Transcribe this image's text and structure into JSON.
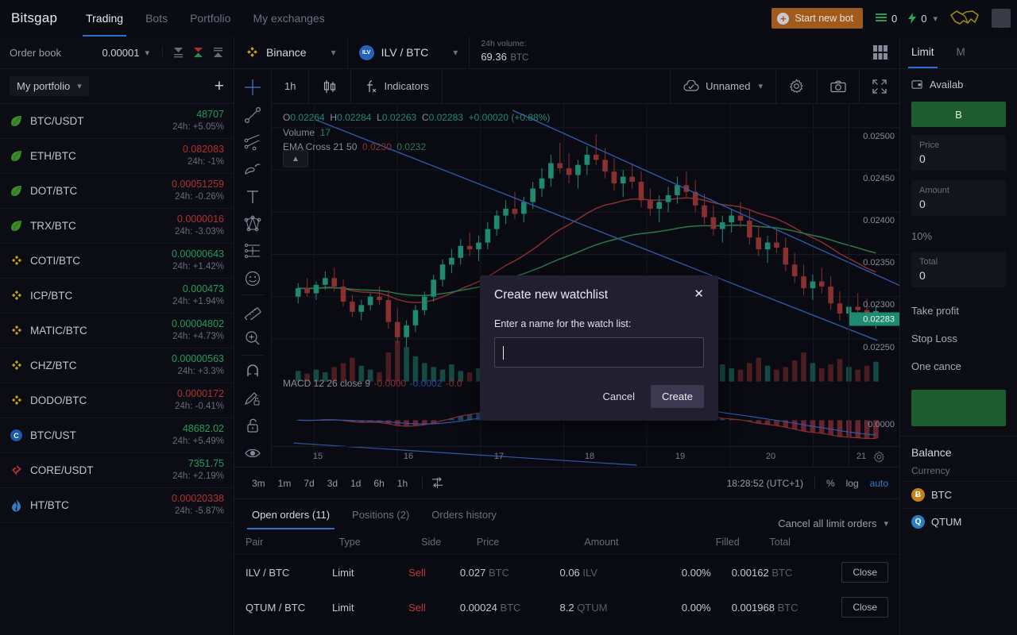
{
  "nav": {
    "brand": "Bitsgap",
    "items": [
      {
        "label": "Trading",
        "active": true
      },
      {
        "label": "Bots",
        "active": false
      },
      {
        "label": "Portfolio",
        "active": false
      },
      {
        "label": "My exchanges",
        "active": false
      }
    ],
    "start_bot_label": "Start new bot",
    "counter_list": "0",
    "counter_bolt": "0"
  },
  "orderbook": {
    "title": "Order book",
    "tick_size": "0.00001"
  },
  "portfolio": {
    "selector_label": "My portfolio",
    "add_label": "+",
    "pairs": [
      {
        "name": "BTC/USDT",
        "price": "48707",
        "change": "24h: +5.05%",
        "dir": "up",
        "icon": "leaf"
      },
      {
        "name": "ETH/BTC",
        "price": "0.082083",
        "change": "24h: -1%",
        "dir": "down",
        "icon": "leaf"
      },
      {
        "name": "DOT/BTC",
        "price": "0.00051259",
        "change": "24h: -0.26%",
        "dir": "down",
        "icon": "leaf"
      },
      {
        "name": "TRX/BTC",
        "price": "0.0000016",
        "change": "24h: -3.03%",
        "dir": "down",
        "icon": "leaf"
      },
      {
        "name": "COTI/BTC",
        "price": "0.00000643",
        "change": "24h: +1.42%",
        "dir": "up",
        "icon": "binance"
      },
      {
        "name": "ICP/BTC",
        "price": "0.000473",
        "change": "24h: +1.94%",
        "dir": "up",
        "icon": "binance"
      },
      {
        "name": "MATIC/BTC",
        "price": "0.00004802",
        "change": "24h: +4.73%",
        "dir": "up",
        "icon": "binance"
      },
      {
        "name": "CHZ/BTC",
        "price": "0.00000563",
        "change": "24h: +3.3%",
        "dir": "up",
        "icon": "binance"
      },
      {
        "name": "DODO/BTC",
        "price": "0.0000172",
        "change": "24h: -0.41%",
        "dir": "down",
        "icon": "binance"
      },
      {
        "name": "BTC/UST",
        "price": "48682.02",
        "change": "24h: +5.49%",
        "dir": "up",
        "icon": "circle-c"
      },
      {
        "name": "CORE/USDT",
        "price": "7351.75",
        "change": "24h: +2.19%",
        "dir": "up",
        "icon": "gate"
      },
      {
        "name": "HT/BTC",
        "price": "0.00020338",
        "change": "24h: -5.87%",
        "dir": "down",
        "icon": "huobi"
      }
    ]
  },
  "market": {
    "exchange": "Binance",
    "pair": "ILV / BTC",
    "pair_badge": "ILV",
    "volume_label": "24h volume:",
    "volume_value": "69.36",
    "volume_unit": "BTC"
  },
  "chart": {
    "timeframe": "1h",
    "indicators_label": "Indicators",
    "layout_name": "Unnamed",
    "ohlc": {
      "o_label": "O",
      "o": "0.02264",
      "h_label": "H",
      "h": "0.02284",
      "l_label": "L",
      "l": "0.02263",
      "c_label": "C",
      "c": "0.02283",
      "change": "+0.00020",
      "change_pct": "(+0.88%)"
    },
    "volume_label": "Volume",
    "volume_value": "17",
    "ema_label": "EMA Cross 21 50",
    "ema_fast": "0.0230",
    "ema_slow": "0.0232",
    "macd_label": "MACD 12 26 close 9",
    "macd_v1": "-0.0000",
    "macd_v2": "-0.0002",
    "macd_v3": "-0.0",
    "price_ticks": [
      "0.02500",
      "0.02450",
      "0.02400",
      "0.02350",
      "0.02300",
      "0.02250"
    ],
    "current_price": "0.02283",
    "zero_tick": "0.0000",
    "time_ticks": [
      "15",
      "16",
      "17",
      "18",
      "19",
      "20",
      "21"
    ],
    "timeframes": [
      "3m",
      "1m",
      "7d",
      "3d",
      "1d",
      "6h",
      "1h"
    ],
    "clock": "18:28:52 (UTC+1)",
    "pct_label": "%",
    "log_label": "log",
    "auto_label": "auto"
  },
  "chart_data": {
    "type": "candlestick",
    "title": "ILV / BTC 1h",
    "xlabel": "",
    "ylabel": "",
    "ylim": [
      0.0222,
      0.02515
    ],
    "xticks": [
      "15",
      "16",
      "17",
      "18",
      "19",
      "20",
      "21"
    ],
    "yticks": [
      0.0225,
      0.023,
      0.0235,
      0.024,
      0.0245,
      0.025
    ],
    "grid": true,
    "legend": "none",
    "up_color": "#1f8a72",
    "down_color": "#8a3030",
    "ema_fast_color": "#8a2f2f",
    "ema_slow_color": "#2a7a4a",
    "trendline_color": "#2f5aa8",
    "last_close": 0.02283,
    "candles": [
      {
        "o": 0.023,
        "h": 0.02316,
        "l": 0.02292,
        "c": 0.0231
      },
      {
        "o": 0.0231,
        "h": 0.02322,
        "l": 0.023,
        "c": 0.02304
      },
      {
        "o": 0.02304,
        "h": 0.02318,
        "l": 0.02296,
        "c": 0.02314
      },
      {
        "o": 0.02314,
        "h": 0.0233,
        "l": 0.02308,
        "c": 0.02322
      },
      {
        "o": 0.02322,
        "h": 0.02334,
        "l": 0.02306,
        "c": 0.02312
      },
      {
        "o": 0.02312,
        "h": 0.0232,
        "l": 0.02288,
        "c": 0.02294
      },
      {
        "o": 0.02294,
        "h": 0.02302,
        "l": 0.02276,
        "c": 0.02282
      },
      {
        "o": 0.02282,
        "h": 0.02296,
        "l": 0.02272,
        "c": 0.0229
      },
      {
        "o": 0.0229,
        "h": 0.02304,
        "l": 0.02284,
        "c": 0.023
      },
      {
        "o": 0.023,
        "h": 0.02312,
        "l": 0.0229,
        "c": 0.02296
      },
      {
        "o": 0.02296,
        "h": 0.02308,
        "l": 0.02262,
        "c": 0.0227
      },
      {
        "o": 0.0227,
        "h": 0.02286,
        "l": 0.02244,
        "c": 0.02252
      },
      {
        "o": 0.02252,
        "h": 0.02272,
        "l": 0.0224,
        "c": 0.02266
      },
      {
        "o": 0.02266,
        "h": 0.0229,
        "l": 0.02258,
        "c": 0.02284
      },
      {
        "o": 0.02284,
        "h": 0.02306,
        "l": 0.02278,
        "c": 0.023
      },
      {
        "o": 0.023,
        "h": 0.02326,
        "l": 0.02294,
        "c": 0.0232
      },
      {
        "o": 0.0232,
        "h": 0.02344,
        "l": 0.02312,
        "c": 0.02338
      },
      {
        "o": 0.02338,
        "h": 0.02356,
        "l": 0.02328,
        "c": 0.02346
      },
      {
        "o": 0.02346,
        "h": 0.02368,
        "l": 0.02338,
        "c": 0.0236
      },
      {
        "o": 0.0236,
        "h": 0.02376,
        "l": 0.02348,
        "c": 0.02356
      },
      {
        "o": 0.02356,
        "h": 0.02372,
        "l": 0.02342,
        "c": 0.02364
      },
      {
        "o": 0.02364,
        "h": 0.02388,
        "l": 0.02356,
        "c": 0.0238
      },
      {
        "o": 0.0238,
        "h": 0.02402,
        "l": 0.02372,
        "c": 0.02396
      },
      {
        "o": 0.02396,
        "h": 0.02414,
        "l": 0.02386,
        "c": 0.02404
      },
      {
        "o": 0.02404,
        "h": 0.02424,
        "l": 0.02392,
        "c": 0.02398
      },
      {
        "o": 0.02398,
        "h": 0.02418,
        "l": 0.02388,
        "c": 0.02412
      },
      {
        "o": 0.02412,
        "h": 0.02436,
        "l": 0.02404,
        "c": 0.02428
      },
      {
        "o": 0.02428,
        "h": 0.02452,
        "l": 0.02418,
        "c": 0.0244
      },
      {
        "o": 0.0244,
        "h": 0.02468,
        "l": 0.0243,
        "c": 0.02458
      },
      {
        "o": 0.02458,
        "h": 0.02482,
        "l": 0.02446,
        "c": 0.02452
      },
      {
        "o": 0.02452,
        "h": 0.0247,
        "l": 0.02434,
        "c": 0.02444
      },
      {
        "o": 0.02444,
        "h": 0.02462,
        "l": 0.02428,
        "c": 0.02456
      },
      {
        "o": 0.02456,
        "h": 0.02478,
        "l": 0.02444,
        "c": 0.02468
      },
      {
        "o": 0.02468,
        "h": 0.02492,
        "l": 0.02456,
        "c": 0.02462
      },
      {
        "o": 0.02462,
        "h": 0.02476,
        "l": 0.0244,
        "c": 0.02448
      },
      {
        "o": 0.02448,
        "h": 0.02464,
        "l": 0.02426,
        "c": 0.02434
      },
      {
        "o": 0.02434,
        "h": 0.0245,
        "l": 0.02418,
        "c": 0.02442
      },
      {
        "o": 0.02442,
        "h": 0.02458,
        "l": 0.02428,
        "c": 0.02436
      },
      {
        "o": 0.02436,
        "h": 0.02448,
        "l": 0.02406,
        "c": 0.02414
      },
      {
        "o": 0.02414,
        "h": 0.02428,
        "l": 0.02396,
        "c": 0.02404
      },
      {
        "o": 0.02404,
        "h": 0.0242,
        "l": 0.02388,
        "c": 0.02412
      },
      {
        "o": 0.02412,
        "h": 0.0243,
        "l": 0.024,
        "c": 0.0242
      },
      {
        "o": 0.0242,
        "h": 0.02442,
        "l": 0.0241,
        "c": 0.02432
      },
      {
        "o": 0.02432,
        "h": 0.02448,
        "l": 0.02418,
        "c": 0.02424
      },
      {
        "o": 0.02424,
        "h": 0.02438,
        "l": 0.024,
        "c": 0.02408
      },
      {
        "o": 0.02408,
        "h": 0.02422,
        "l": 0.02386,
        "c": 0.02394
      },
      {
        "o": 0.02394,
        "h": 0.02408,
        "l": 0.02372,
        "c": 0.0238
      },
      {
        "o": 0.0238,
        "h": 0.02396,
        "l": 0.02364,
        "c": 0.02388
      },
      {
        "o": 0.02388,
        "h": 0.02404,
        "l": 0.02376,
        "c": 0.02396
      },
      {
        "o": 0.02396,
        "h": 0.02412,
        "l": 0.02382,
        "c": 0.0239
      },
      {
        "o": 0.0239,
        "h": 0.02402,
        "l": 0.02362,
        "c": 0.0237
      },
      {
        "o": 0.0237,
        "h": 0.02384,
        "l": 0.02348,
        "c": 0.02356
      },
      {
        "o": 0.02356,
        "h": 0.02372,
        "l": 0.0234,
        "c": 0.02364
      },
      {
        "o": 0.02364,
        "h": 0.0238,
        "l": 0.02352,
        "c": 0.02358
      },
      {
        "o": 0.02358,
        "h": 0.0237,
        "l": 0.0233,
        "c": 0.02338
      },
      {
        "o": 0.02338,
        "h": 0.02352,
        "l": 0.02316,
        "c": 0.02324
      },
      {
        "o": 0.02324,
        "h": 0.02338,
        "l": 0.02302,
        "c": 0.0231
      },
      {
        "o": 0.0231,
        "h": 0.02326,
        "l": 0.02296,
        "c": 0.02318
      },
      {
        "o": 0.02318,
        "h": 0.02334,
        "l": 0.02304,
        "c": 0.02312
      },
      {
        "o": 0.02312,
        "h": 0.02324,
        "l": 0.02284,
        "c": 0.02292
      },
      {
        "o": 0.02292,
        "h": 0.02306,
        "l": 0.02272,
        "c": 0.0228
      },
      {
        "o": 0.0228,
        "h": 0.02296,
        "l": 0.02268,
        "c": 0.02288
      },
      {
        "o": 0.02288,
        "h": 0.02304,
        "l": 0.02276,
        "c": 0.02284
      },
      {
        "o": 0.02284,
        "h": 0.02298,
        "l": 0.02266,
        "c": 0.02274
      },
      {
        "o": 0.02274,
        "h": 0.0229,
        "l": 0.02262,
        "c": 0.02283
      }
    ],
    "volume_bars": [
      8,
      6,
      9,
      7,
      11,
      14,
      18,
      12,
      9,
      7,
      22,
      31,
      26,
      19,
      14,
      11,
      9,
      13,
      8,
      7,
      10,
      12,
      9,
      11,
      14,
      10,
      8,
      12,
      16,
      21,
      14,
      11,
      9,
      13,
      17,
      12,
      9,
      8,
      11,
      14,
      10,
      9,
      12,
      15,
      19,
      24,
      17,
      13,
      10,
      9,
      14,
      18,
      12,
      9,
      11,
      16,
      22,
      14,
      10,
      13,
      17,
      11,
      9,
      12,
      15
    ]
  },
  "orders": {
    "tabs": [
      {
        "label": "Open orders (11)",
        "active": true
      },
      {
        "label": "Positions (2)",
        "active": false
      },
      {
        "label": "Orders history",
        "active": false
      }
    ],
    "cancel_all_label": "Cancel all limit orders",
    "columns": [
      "Pair",
      "Type",
      "Side",
      "Price",
      "Amount",
      "Filled",
      "Total"
    ],
    "rows": [
      {
        "pair": "ILV / BTC",
        "type": "Limit",
        "side": "Sell",
        "price": "0.027",
        "price_unit": "BTC",
        "amount": "0.06",
        "amount_unit": "ILV",
        "filled": "0.00%",
        "total": "0.00162",
        "total_unit": "BTC",
        "action": "Close"
      },
      {
        "pair": "QTUM / BTC",
        "type": "Limit",
        "side": "Sell",
        "price": "0.00024",
        "price_unit": "BTC",
        "amount": "8.2",
        "amount_unit": "QTUM",
        "filled": "0.00%",
        "total": "0.001968",
        "total_unit": "BTC",
        "action": "Close"
      }
    ]
  },
  "trade_panel": {
    "tabs": [
      {
        "label": "Limit",
        "active": true
      },
      {
        "label": "M",
        "active": false
      }
    ],
    "available_label": "Availab",
    "buy_label": "B",
    "price_label": "Price",
    "price_value": "0",
    "amount_label": "Amount",
    "amount_value": "0",
    "pct_label": "10%",
    "total_label": "Total",
    "total_value": "0",
    "take_profit_label": "Take profit",
    "stop_loss_label": "Stop Loss",
    "one_cancel_label": "One cance",
    "balance_label": "Balance",
    "currency_label": "Currency",
    "coins": [
      {
        "symbol": "BTC",
        "letter": "Ƀ",
        "color": "#c4821a"
      },
      {
        "symbol": "QTUM",
        "letter": "Q",
        "color": "#2a7fc0"
      }
    ]
  },
  "modal": {
    "title": "Create new watchlist",
    "close_label": "✕",
    "field_label": "Enter a name for the watch list:",
    "input_value": "",
    "input_placeholder": "",
    "cancel_label": "Cancel",
    "create_label": "Create"
  }
}
